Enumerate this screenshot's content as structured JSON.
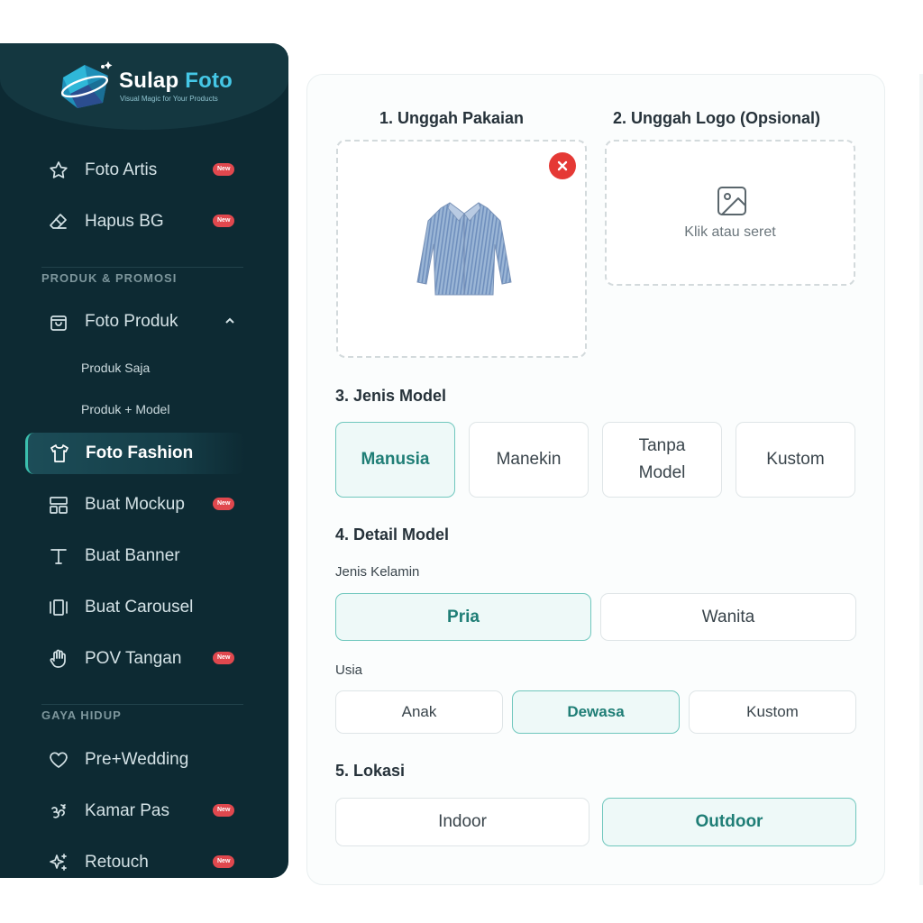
{
  "brand": {
    "name_part1": "Sulap",
    "name_part2": "Foto",
    "tagline": "Visual Magic for Your Products"
  },
  "sidebar": {
    "top_items": [
      {
        "label": "Foto Artis",
        "icon": "star-icon",
        "badge": "New"
      },
      {
        "label": "Hapus BG",
        "icon": "eraser-icon",
        "badge": "New"
      }
    ],
    "section_produk": "PRODUK & PROMOSI",
    "foto_produk": {
      "label": "Foto Produk",
      "icon": "bag-icon",
      "subitems": [
        "Produk Saja",
        "Produk + Model"
      ]
    },
    "produk_items": [
      {
        "label": "Foto Fashion",
        "icon": "shirt-icon",
        "active": true
      },
      {
        "label": "Buat Mockup",
        "icon": "layout-icon",
        "badge": "New"
      },
      {
        "label": "Buat Banner",
        "icon": "text-icon"
      },
      {
        "label": "Buat Carousel",
        "icon": "carousel-icon"
      },
      {
        "label": "POV Tangan",
        "icon": "hand-icon",
        "badge": "New"
      }
    ],
    "section_gaya": "GAYA HIDUP",
    "gaya_items": [
      {
        "label": "Pre+Wedding",
        "icon": "heart-icon"
      },
      {
        "label": "Kamar Pas",
        "icon": "om-icon",
        "badge": "New"
      },
      {
        "label": "Retouch",
        "icon": "sparkle-icon",
        "badge": "New"
      }
    ]
  },
  "form": {
    "upload_clothes_label": "1. Unggah Pakaian",
    "upload_logo_label": "2. Unggah Logo (Opsional)",
    "upload_logo_hint": "Klik atau seret",
    "model_type_label": "3. Jenis Model",
    "model_types": [
      "Manusia",
      "Manekin",
      "Tanpa Model",
      "Kustom"
    ],
    "model_type_selected": "Manusia",
    "model_detail_label": "4. Detail Model",
    "gender_label": "Jenis Kelamin",
    "genders": [
      "Pria",
      "Wanita"
    ],
    "gender_selected": "Pria",
    "age_label": "Usia",
    "ages": [
      "Anak",
      "Dewasa",
      "Kustom"
    ],
    "age_selected": "Dewasa",
    "location_label": "5. Lokasi",
    "locations": [
      "Indoor",
      "Outdoor"
    ],
    "location_selected": "Outdoor"
  },
  "colors": {
    "sidebar_bg": "#0d2a33",
    "accent_teal": "#1f7e76",
    "badge_red": "#e0484e",
    "remove_red": "#e53935"
  }
}
